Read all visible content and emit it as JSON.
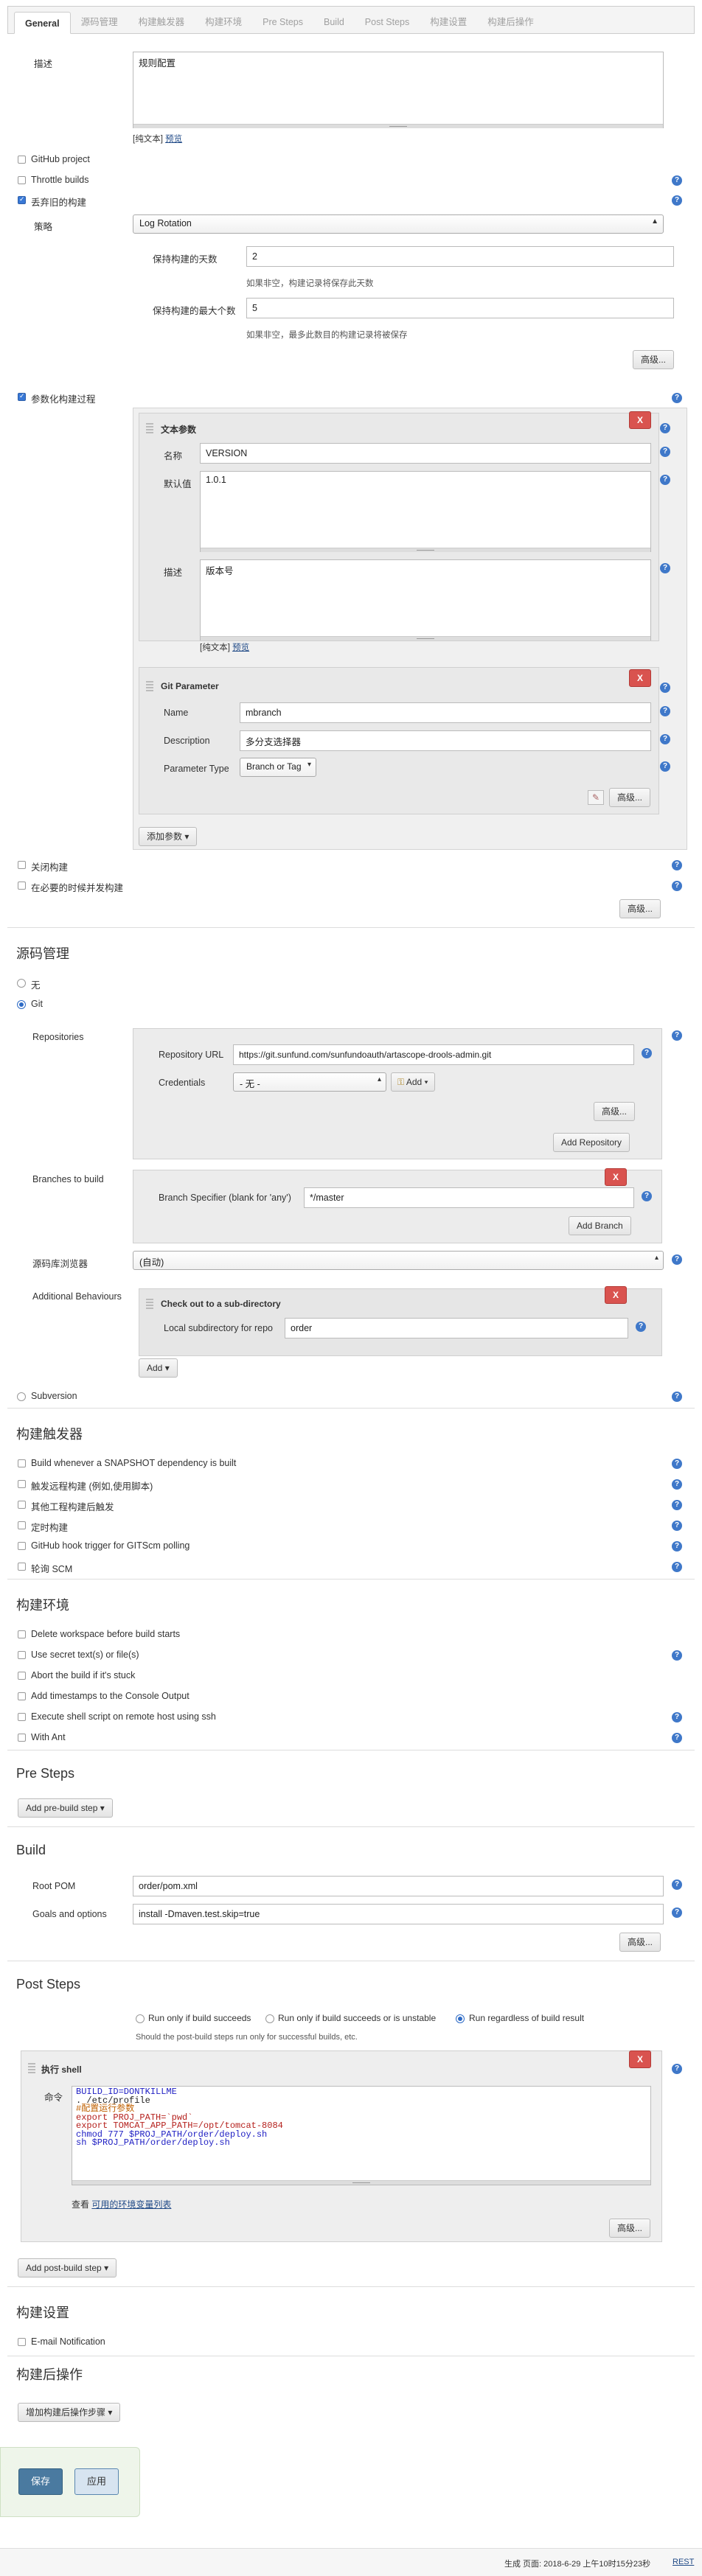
{
  "tabs": [
    "General",
    "源码管理",
    "构建触发器",
    "构建环境",
    "Pre Steps",
    "Build",
    "Post Steps",
    "构建设置",
    "构建后操作"
  ],
  "general": {
    "description_label": "描述",
    "description_value": "规则配置",
    "plain_text": "[纯文本]",
    "preview": "预览",
    "github_project": "GitHub project",
    "throttle_builds": "Throttle builds",
    "discard_old": "丢弃旧的构建",
    "strategy_label": "策略",
    "strategy_value": "Log Rotation",
    "days_label": "保持构建的天数",
    "days_value": "2",
    "days_hint": "如果非空，构建记录将保存此天数",
    "max_label": "保持构建的最大个数",
    "max_value": "5",
    "max_hint": "如果非空，最多此数目的构建记录将被保存",
    "advanced": "高级...",
    "parameterized": "参数化构建过程",
    "string_param": {
      "title": "文本参数",
      "name_label": "名称",
      "name_value": "VERSION",
      "default_label": "默认值",
      "default_value": "1.0.1",
      "desc_label": "描述",
      "desc_value": "版本号"
    },
    "git_param": {
      "title": "Git Parameter",
      "name_label": "Name",
      "name_value": "mbranch",
      "desc_label": "Description",
      "desc_value": "多分支选择器",
      "type_label": "Parameter Type",
      "type_value": "Branch or Tag"
    },
    "add_param": "添加参数",
    "disable_build": "关闭构建",
    "concurrent": "在必要的时候并发构建"
  },
  "scm": {
    "title": "源码管理",
    "none": "无",
    "git": "Git",
    "repositories_label": "Repositories",
    "repo_url_label": "Repository URL",
    "repo_url_value": "https://git.sunfund.com/sunfundoauth/artascope-drools-admin.git",
    "credentials_label": "Credentials",
    "credentials_value": "- 无 -",
    "add_cred": "Add",
    "add_repo": "Add Repository",
    "branches_label": "Branches to build",
    "branch_spec_label": "Branch Specifier (blank for 'any')",
    "branch_spec_value": "*/master",
    "add_branch": "Add Branch",
    "browser_label": "源码库浏览器",
    "browser_value": "(自动)",
    "behaviours_label": "Additional Behaviours",
    "checkout_title": "Check out to a sub-directory",
    "subdir_label": "Local subdirectory for repo",
    "subdir_value": "order",
    "add": "Add",
    "subversion": "Subversion"
  },
  "triggers": {
    "title": "构建触发器",
    "items": [
      "Build whenever a SNAPSHOT dependency is built",
      "触发远程构建 (例如,使用脚本)",
      "其他工程构建后触发",
      "定时构建",
      "GitHub hook trigger for GITScm polling",
      "轮询 SCM"
    ]
  },
  "env": {
    "title": "构建环境",
    "items": [
      "Delete workspace before build starts",
      "Use secret text(s) or file(s)",
      "Abort the build if it's stuck",
      "Add timestamps to the Console Output",
      "Execute shell script on remote host using ssh",
      "With Ant"
    ]
  },
  "presteps": {
    "title": "Pre Steps",
    "add": "Add pre-build step"
  },
  "build": {
    "title": "Build",
    "pom_label": "Root POM",
    "pom_value": "order/pom.xml",
    "goals_label": "Goals and options",
    "goals_value": "install -Dmaven.test.skip=true"
  },
  "poststeps": {
    "title": "Post Steps",
    "opt1": "Run only if build succeeds",
    "opt2": "Run only if build succeeds or is unstable",
    "opt3": "Run regardless of build result",
    "hint": "Should the post-build steps run only for successful builds, etc.",
    "shell_title": "执行 shell",
    "cmd_label": "命令",
    "code": [
      "BUILD_ID=DONTKILLME",
      ". /etc/profile",
      "#配置运行参数",
      "export PROJ_PATH=`pwd`",
      "export TOMCAT_APP_PATH=/opt/tomcat-8084",
      "chmod 777 $PROJ_PATH/order/deploy.sh",
      "sh $PROJ_PATH/order/deploy.sh"
    ],
    "env_hint": "查看",
    "env_link": "可用的环境变量列表",
    "add": "Add post-build step"
  },
  "settings": {
    "title": "构建设置",
    "email": "E-mail Notification"
  },
  "postbuild": {
    "title": "构建后操作",
    "add": "增加构建后操作步骤"
  },
  "actions": {
    "save": "保存",
    "apply": "应用"
  },
  "footer": {
    "generated": "生成 页面: 2018-6-29 上午10时15分23秒",
    "rest": "REST"
  }
}
